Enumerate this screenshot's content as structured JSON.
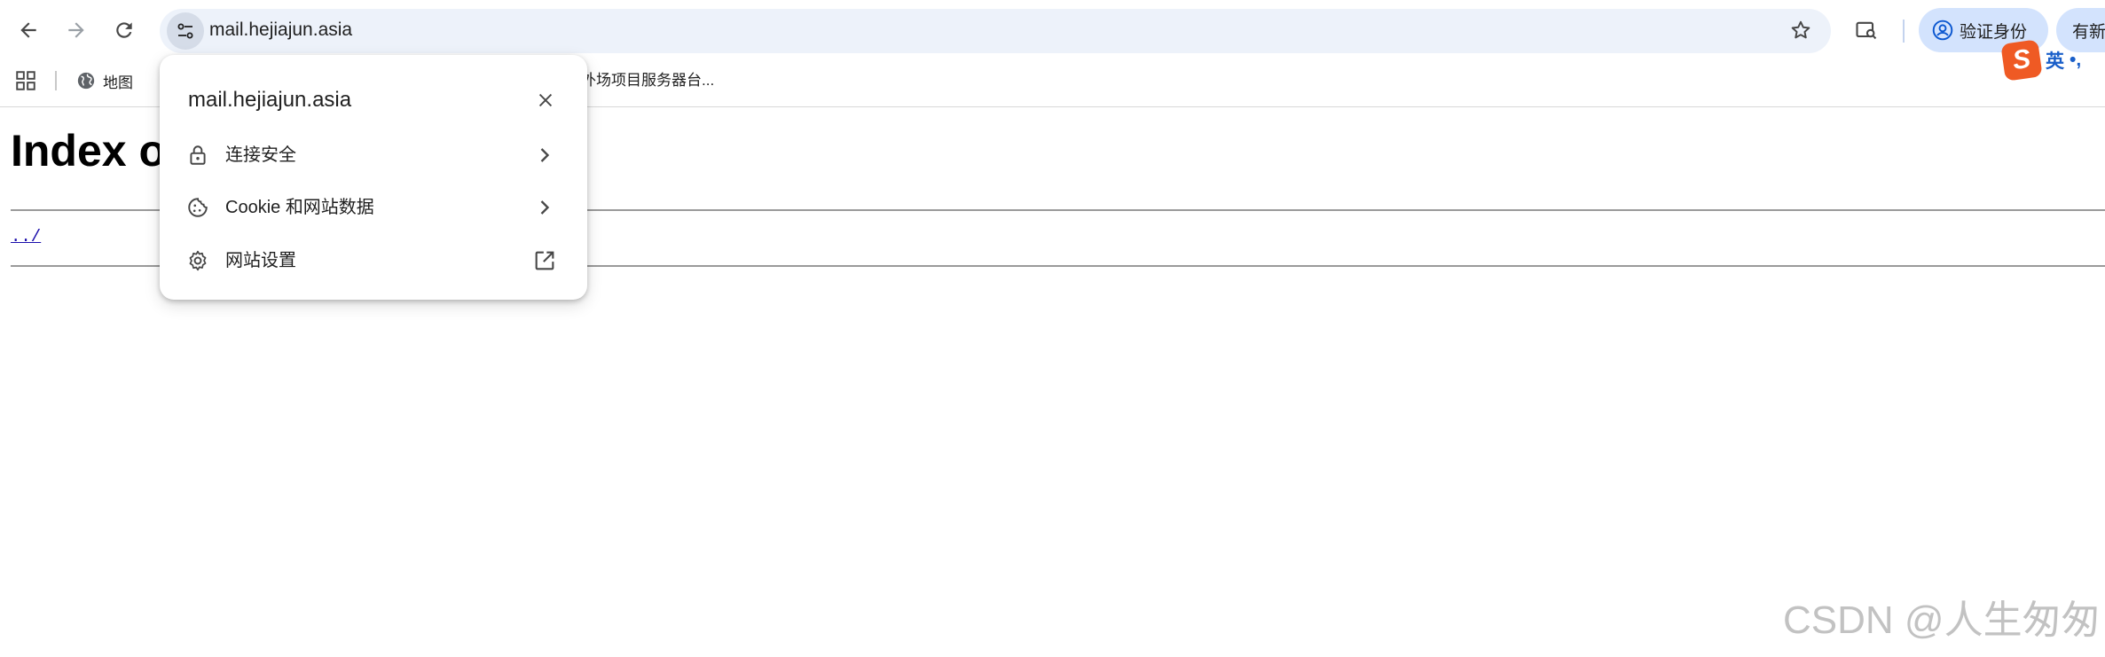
{
  "browser": {
    "url": "mail.hejiajun.asia",
    "verify_label": "验证身份",
    "new_label": "有新"
  },
  "bookmarks": {
    "items": [
      {
        "label": "地图"
      },
      {
        "label": "外场项目服务器台..."
      }
    ]
  },
  "site_info_popup": {
    "title": "mail.hejiajun.asia",
    "items": [
      {
        "label": "连接安全",
        "icon": "lock-icon",
        "trailing": "chevron-right-icon"
      },
      {
        "label": "Cookie 和网站数据",
        "icon": "cookie-icon",
        "trailing": "chevron-right-icon"
      },
      {
        "label": "网站设置",
        "icon": "gear-icon",
        "trailing": "open-in-new-icon"
      }
    ]
  },
  "page": {
    "heading": "Index o",
    "parent_link": "../"
  },
  "ime": {
    "mode": "英",
    "punct": "•,"
  },
  "watermark": "CSDN @人生匆匆",
  "colors": {
    "omnibox_bg": "#edf2fa",
    "chip_bg": "#d3e3fd",
    "link": "#1a0dab",
    "ime_logo": "#ef5a24",
    "ime_text": "#1a5fc9"
  }
}
